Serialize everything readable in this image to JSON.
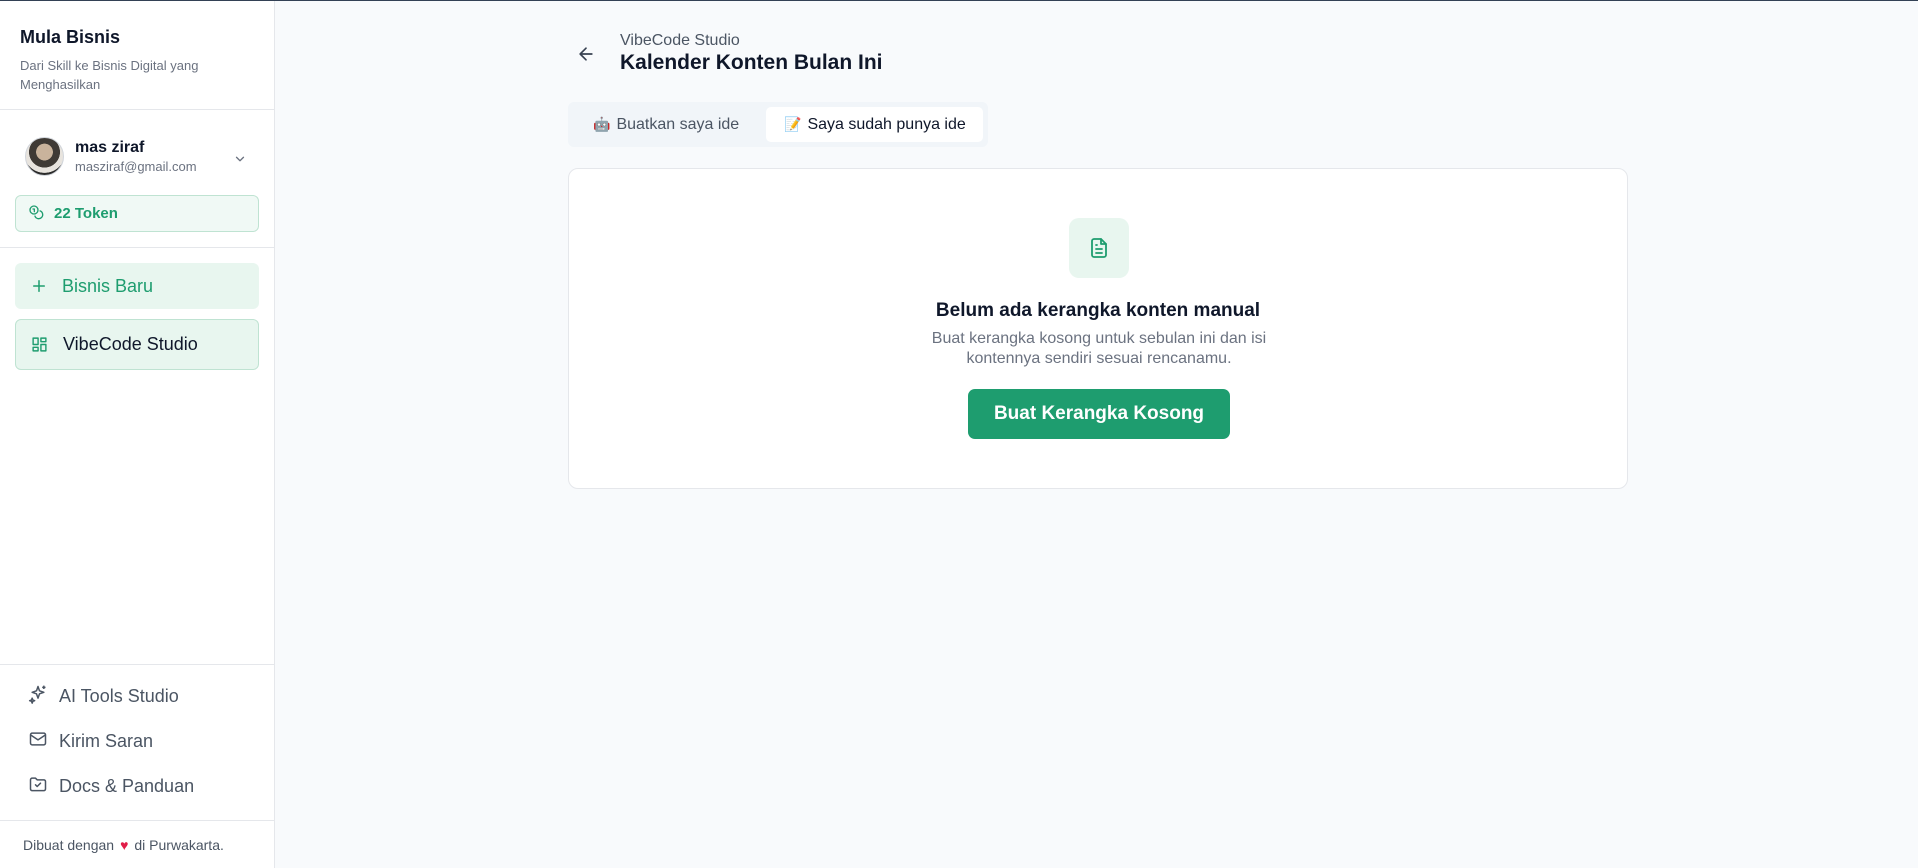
{
  "brand": {
    "title": "Mula Bisnis",
    "subtitle": "Dari Skill ke Bisnis Digital yang Menghasilkan"
  },
  "user": {
    "name": "mas ziraf",
    "email": "masziraf@gmail.com"
  },
  "token": {
    "label": "22 Token"
  },
  "nav": {
    "new_business": "Bisnis Baru",
    "vibecode": "VibeCode Studio"
  },
  "bottom_links": [
    {
      "label": "AI Tools Studio",
      "icon": "sparkles-icon"
    },
    {
      "label": "Kirim Saran",
      "icon": "mail-icon"
    },
    {
      "label": "Docs & Panduan",
      "icon": "folder-check-icon"
    }
  ],
  "footer": {
    "prefix": "Dibuat dengan",
    "suffix": "di Purwakarta."
  },
  "header": {
    "breadcrumb": "VibeCode Studio",
    "title": "Kalender Konten Bulan Ini"
  },
  "tabs": [
    {
      "label": "Buatkan saya ide",
      "emoji": "🤖",
      "active": false
    },
    {
      "label": "Saya sudah punya ide",
      "emoji": "📝",
      "active": true
    }
  ],
  "empty_state": {
    "title": "Belum ada kerangka konten manual",
    "description": "Buat kerangka kosong untuk sebulan ini dan isi kontennya sendiri sesuai rencanamu.",
    "button": "Buat Kerangka Kosong"
  },
  "colors": {
    "accent": "#1e9d6f",
    "accent_soft": "#e8f6ef",
    "background": "#f8fafc"
  }
}
